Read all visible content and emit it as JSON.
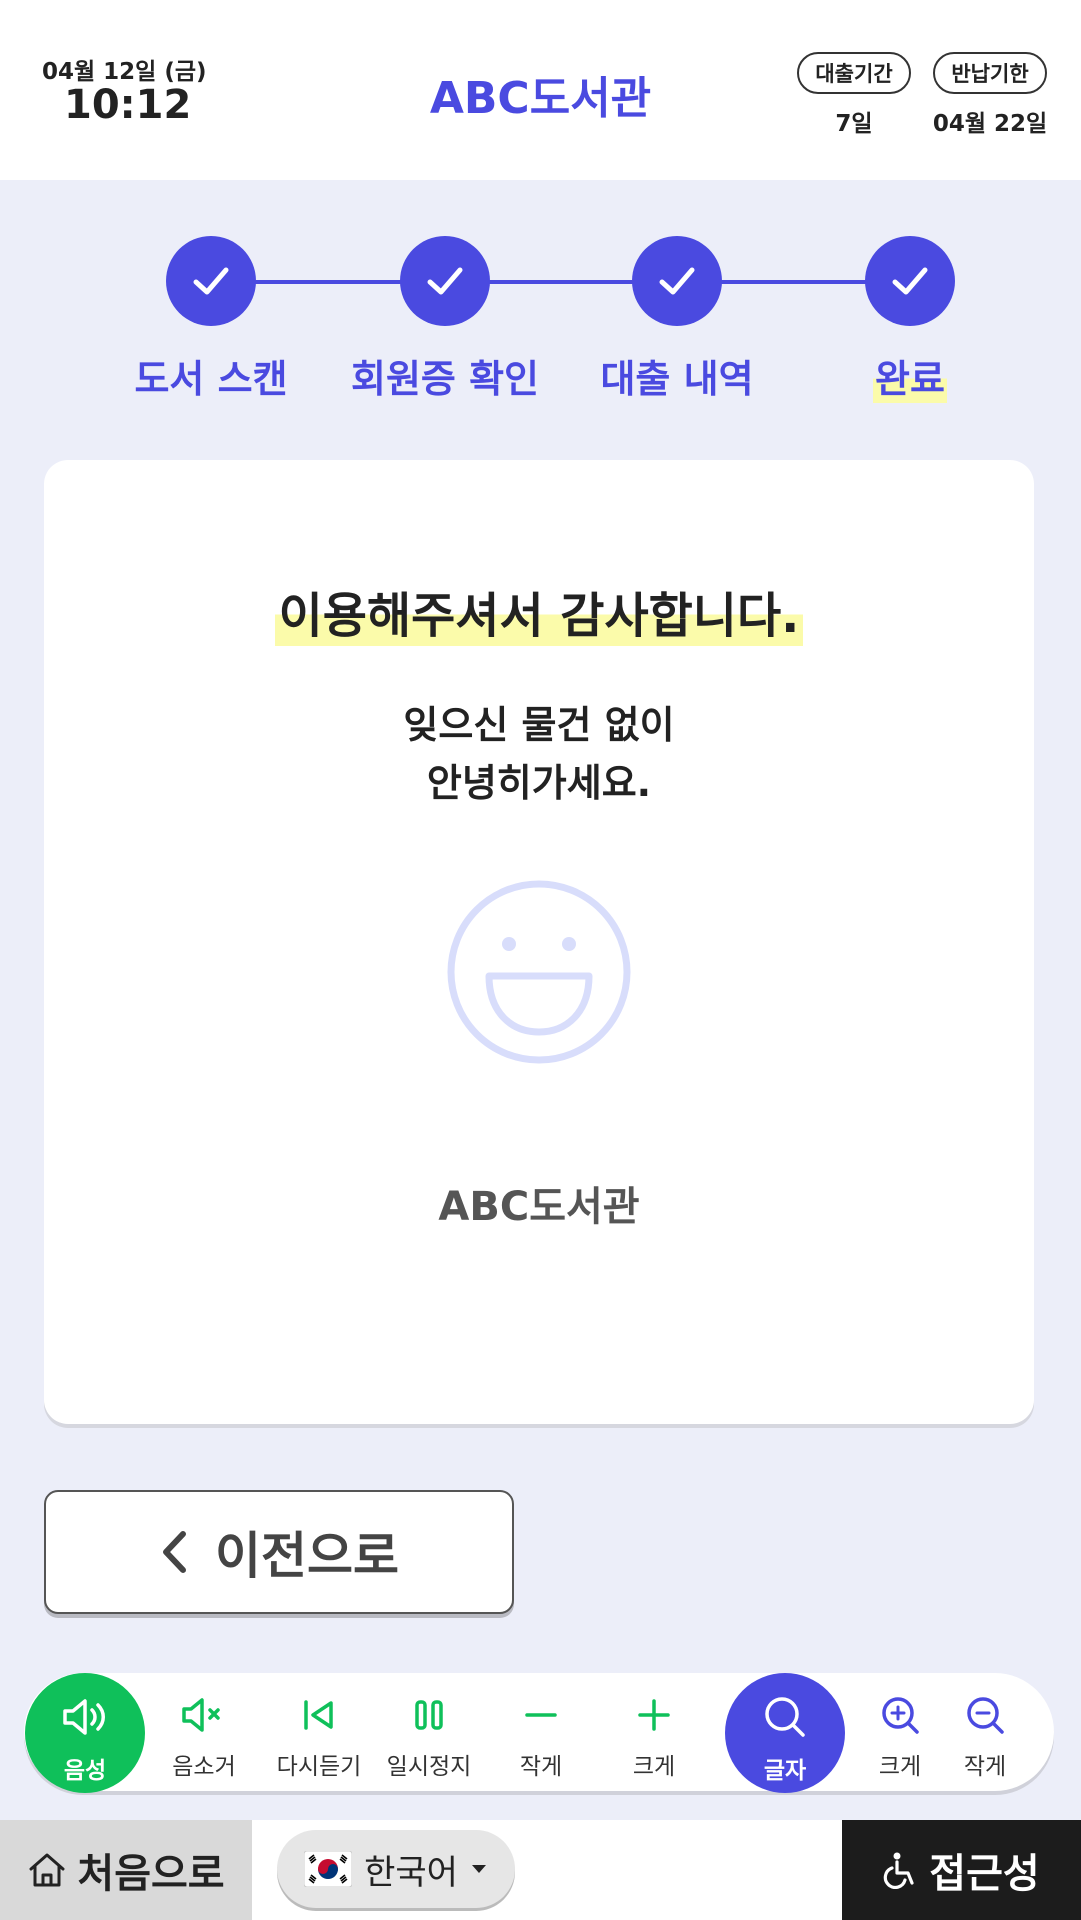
{
  "header": {
    "date": "04월 12일 (금)",
    "time": "10:12",
    "title": "ABC도서관",
    "loan_period_label": "대출기간",
    "loan_period_value": "7일",
    "return_due_label": "반납기한",
    "return_due_value": "04월 22일"
  },
  "steps": [
    {
      "label": "도서 스캔"
    },
    {
      "label": "회원증 확인"
    },
    {
      "label": "대출 내역"
    },
    {
      "label": "완료"
    }
  ],
  "card": {
    "thanks": "이용해주셔서 감사합니다.",
    "message_line1": "잊으신 물건 없이",
    "message_line2": "안녕히가세요.",
    "library_name": "ABC도서관"
  },
  "back_button": {
    "label": "이전으로"
  },
  "toolbar": {
    "voice": "음성",
    "mute": "음소거",
    "replay": "다시듣기",
    "pause": "일시정지",
    "volume_down": "작게",
    "volume_up": "크게",
    "text": "글자",
    "text_bigger": "크게",
    "text_smaller": "작게"
  },
  "bottom": {
    "home": "처음으로",
    "language": "한국어",
    "accessibility": "접근성"
  },
  "colors": {
    "accent": "#4a4ae0",
    "voice_green": "#0fc05a",
    "highlight": "#fbfbaa",
    "background": "#eceef9"
  }
}
